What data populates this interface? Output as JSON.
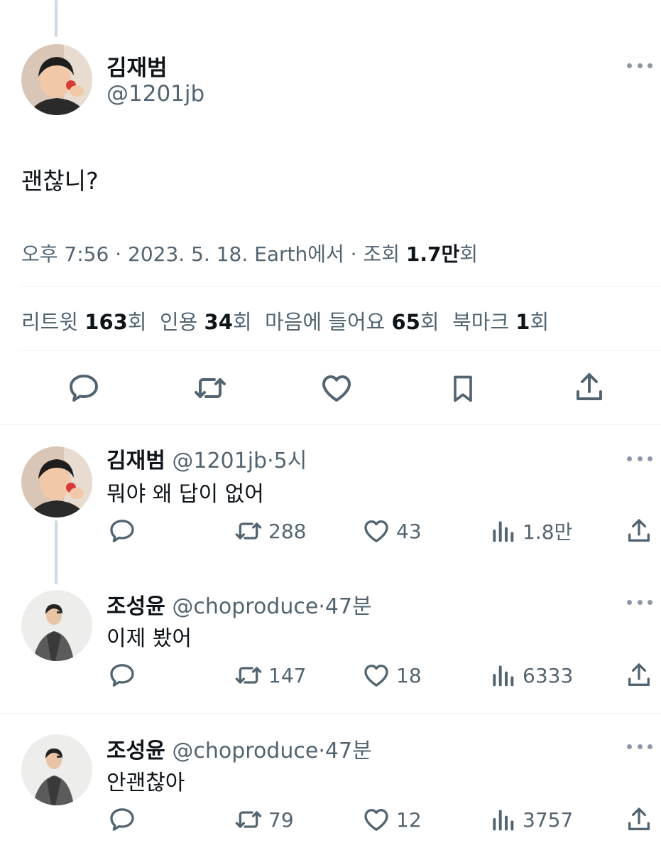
{
  "main_tweet": {
    "author_name": "김재범",
    "author_handle": "@1201jb",
    "text": "괜찮니?",
    "time": "오후 7:56",
    "date": "2023. 5. 18.",
    "source": "Earth에서",
    "views_label": "조회",
    "views_value": "1.7만",
    "views_unit": "회",
    "stats": {
      "retweets_label": "리트윗",
      "retweets_value": "163",
      "quotes_label": "인용",
      "quotes_value": "34",
      "likes_label": "마음에 들어요",
      "likes_value": "65",
      "bookmarks_label": "북마크",
      "bookmarks_value": "1",
      "unit": "회"
    }
  },
  "replies": [
    {
      "author_name": "김재범",
      "author_handle": "@1201jb",
      "time": "5시",
      "text": "뭐야 왜 답이 없어",
      "retweets": "288",
      "likes": "43",
      "views": "1.8만"
    },
    {
      "author_name": "조성윤",
      "author_handle": "@choproduce",
      "time": "47분",
      "text": "이제 봤어",
      "retweets": "147",
      "likes": "18",
      "views": "6333"
    },
    {
      "author_name": "조성윤",
      "author_handle": "@choproduce",
      "time": "47분",
      "text": "안괜찮아",
      "retweets": "79",
      "likes": "12",
      "views": "3757"
    }
  ],
  "separator": "·",
  "icons": [
    "reply-icon",
    "retweet-icon",
    "like-icon",
    "bookmark-icon",
    "share-icon",
    "views-icon",
    "more-icon"
  ],
  "colors": {
    "text": "#0f1419",
    "muted": "#536471",
    "divider": "#eff3f4",
    "thread_line": "#cfd9de"
  }
}
